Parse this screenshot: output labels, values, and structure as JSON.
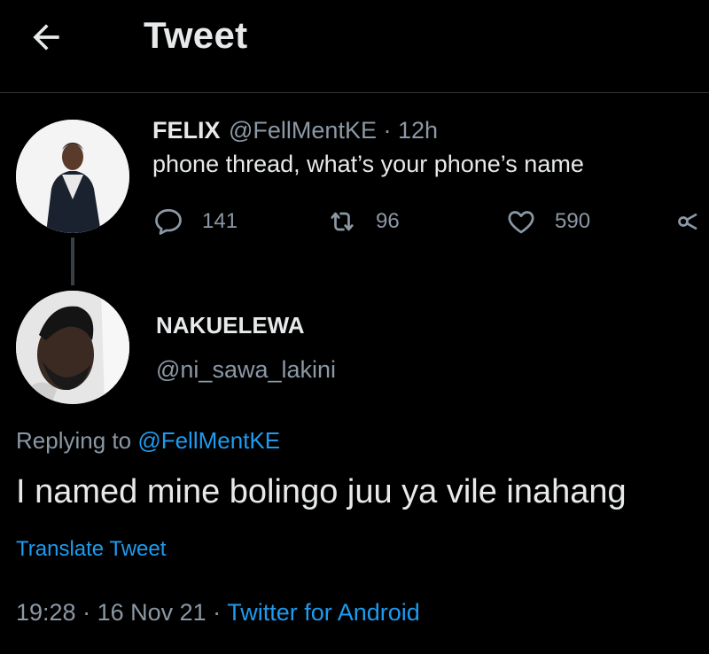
{
  "header": {
    "title": "Tweet",
    "back_icon": "arrow-left-icon"
  },
  "parent_tweet": {
    "name": "FELIX",
    "handle": "@FellMentKE",
    "time": "· 12h",
    "text": "phone thread, what’s your phone’s name",
    "replies": "141",
    "retweets": "96",
    "likes": "590"
  },
  "reply_tweet": {
    "name": "NAKUELEWA",
    "handle": "@ni_sawa_lakini",
    "replying_prefix": "Replying to ",
    "replying_to": "@FellMentKE",
    "text": "I named mine bolingo juu ya vile inahang",
    "translate": "Translate Tweet",
    "time": "19:28",
    "sep1": " · ",
    "date": "16 Nov 21",
    "sep2": " · ",
    "source": "Twitter for Android"
  },
  "colors": {
    "background": "#000000",
    "accent": "#1d9bf0",
    "muted": "#8b98a5"
  }
}
